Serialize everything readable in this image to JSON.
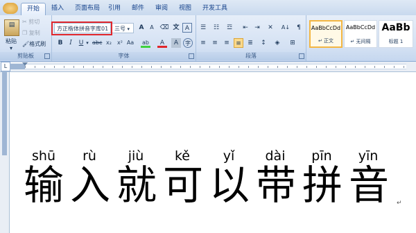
{
  "tabs": [
    "开始",
    "插入",
    "页面布局",
    "引用",
    "邮件",
    "审阅",
    "视图",
    "开发工具"
  ],
  "clipboard": {
    "paste": "粘贴",
    "cut": "剪切",
    "copy": "复制",
    "format_painter": "格式刷",
    "label": "剪贴板"
  },
  "font": {
    "name": "方正楷体拼音字库01",
    "size": "三号",
    "label": "字体",
    "grow": "A",
    "shrink": "A",
    "change_case": "Aa"
  },
  "paragraph": {
    "label": "段落"
  },
  "styles": [
    {
      "preview": "AaBbCcDd",
      "name": "↵ 正文"
    },
    {
      "preview": "AaBbCcDd",
      "name": "↵ 无间隔"
    },
    {
      "preview": "AaBb",
      "name": "标题 1"
    }
  ],
  "document": {
    "pinyin": [
      "shū",
      "rù",
      "jiù",
      "kě",
      "yǐ",
      "dài",
      "pīn",
      "yīn"
    ],
    "hanzi": [
      "输",
      "入",
      "就",
      "可",
      "以",
      "带",
      "拼",
      "音"
    ],
    "paragraph_mark": "↵"
  },
  "colors": {
    "accent": "#15428b",
    "highlight": "#f3b642",
    "outline": "#e0262b"
  }
}
